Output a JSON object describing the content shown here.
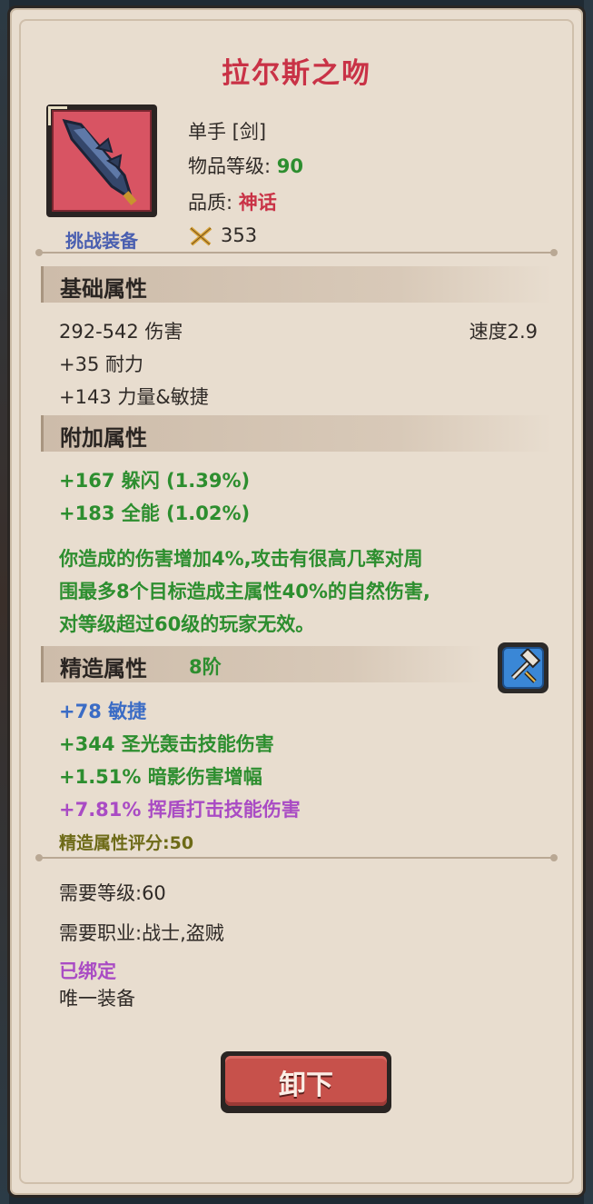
{
  "item": {
    "name": "拉尔斯之吻",
    "caption": "挑战装备",
    "type": "单手 [剑]",
    "level_label": "物品等级:",
    "level_value": "90",
    "quality_label": "品质:",
    "quality_value": "神话",
    "score": "353"
  },
  "base": {
    "header": "基础属性",
    "damage": "292-542 伤害",
    "speed": "速度2.9",
    "stats": [
      "+35 耐力",
      "+143 力量&敏捷"
    ]
  },
  "bonus": {
    "header": "附加属性",
    "stats": [
      "+167 躲闪 (1.39%)",
      "+183 全能 (1.02%)"
    ],
    "effect_lines": [
      "你造成的伤害增加4%,攻击有很高几率对周",
      "围最多8个目标造成主属性40%的自然伤害,",
      "对等级超过60级的玩家无效。"
    ]
  },
  "crafting": {
    "header": "精造属性",
    "tier": "8阶",
    "stats": [
      {
        "text": "+78 敏捷",
        "color": "#3b6cc5"
      },
      {
        "text": "+344 圣光轰击技能伤害",
        "color": "#2d8e2f"
      },
      {
        "text": "+1.51% 暗影伤害增幅",
        "color": "#2d8e2f"
      },
      {
        "text": "+7.81% 挥盾打击技能伤害",
        "color": "#a94bc4"
      }
    ],
    "score_label": "精造属性评分:50"
  },
  "requirements": {
    "level": "需要等级:60",
    "classes": "需要职业:战士,盗贼",
    "bound": "已绑定",
    "unique": "唯一装备"
  },
  "buttons": {
    "unequip": "卸下"
  },
  "icons": {
    "item": "sword-icon",
    "score": "crossed-swords-icon",
    "craft": "hammer-icon"
  }
}
